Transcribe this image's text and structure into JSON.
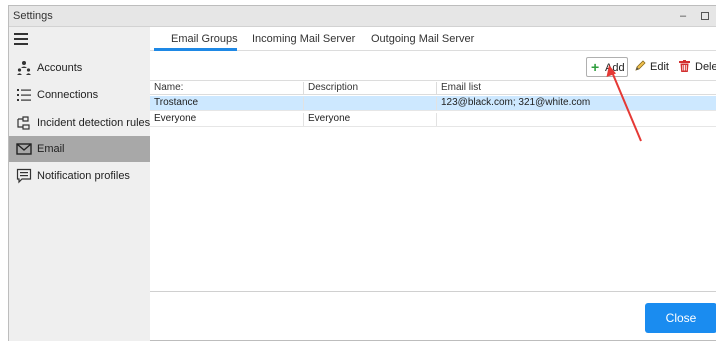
{
  "window": {
    "title": "Settings",
    "controls": {
      "minimize": "–",
      "close": "X"
    }
  },
  "sidebar": {
    "menu_icon": "hamburger-icon",
    "items": [
      {
        "label": "Accounts",
        "icon": "accounts-icon",
        "active": false
      },
      {
        "label": "Connections",
        "icon": "list-icon",
        "active": false
      },
      {
        "label": "Incident detection rules",
        "icon": "rules-icon",
        "active": false
      },
      {
        "label": "Email",
        "icon": "envelope-icon",
        "active": true
      },
      {
        "label": "Notification profiles",
        "icon": "notification-icon",
        "active": false
      }
    ]
  },
  "tabs": [
    {
      "label": "Email Groups",
      "active": true
    },
    {
      "label": "Incoming Mail Server",
      "active": false
    },
    {
      "label": "Outgoing Mail Server",
      "active": false
    }
  ],
  "toolbar": {
    "add_label": "Add",
    "edit_label": "Edit",
    "delete_label": "Delete"
  },
  "table": {
    "columns": [
      "Name:",
      "Description",
      "Email list"
    ],
    "rows": [
      {
        "name": "Trostance",
        "description": "",
        "email_list": "123@black.com; 321@white.com",
        "selected": true
      },
      {
        "name": "Everyone",
        "description": "Everyone",
        "email_list": "",
        "selected": false
      }
    ]
  },
  "footer": {
    "close_label": "Close"
  },
  "colors": {
    "accent": "#1e88e5",
    "close_button": "#1a8cf0",
    "selected_row": "#cde8ff",
    "active_sidebar": "#a8a8a8",
    "annotation_arrow": "#e53935",
    "add_icon": "#2e9e3c",
    "delete_icon": "#d32f2f"
  }
}
